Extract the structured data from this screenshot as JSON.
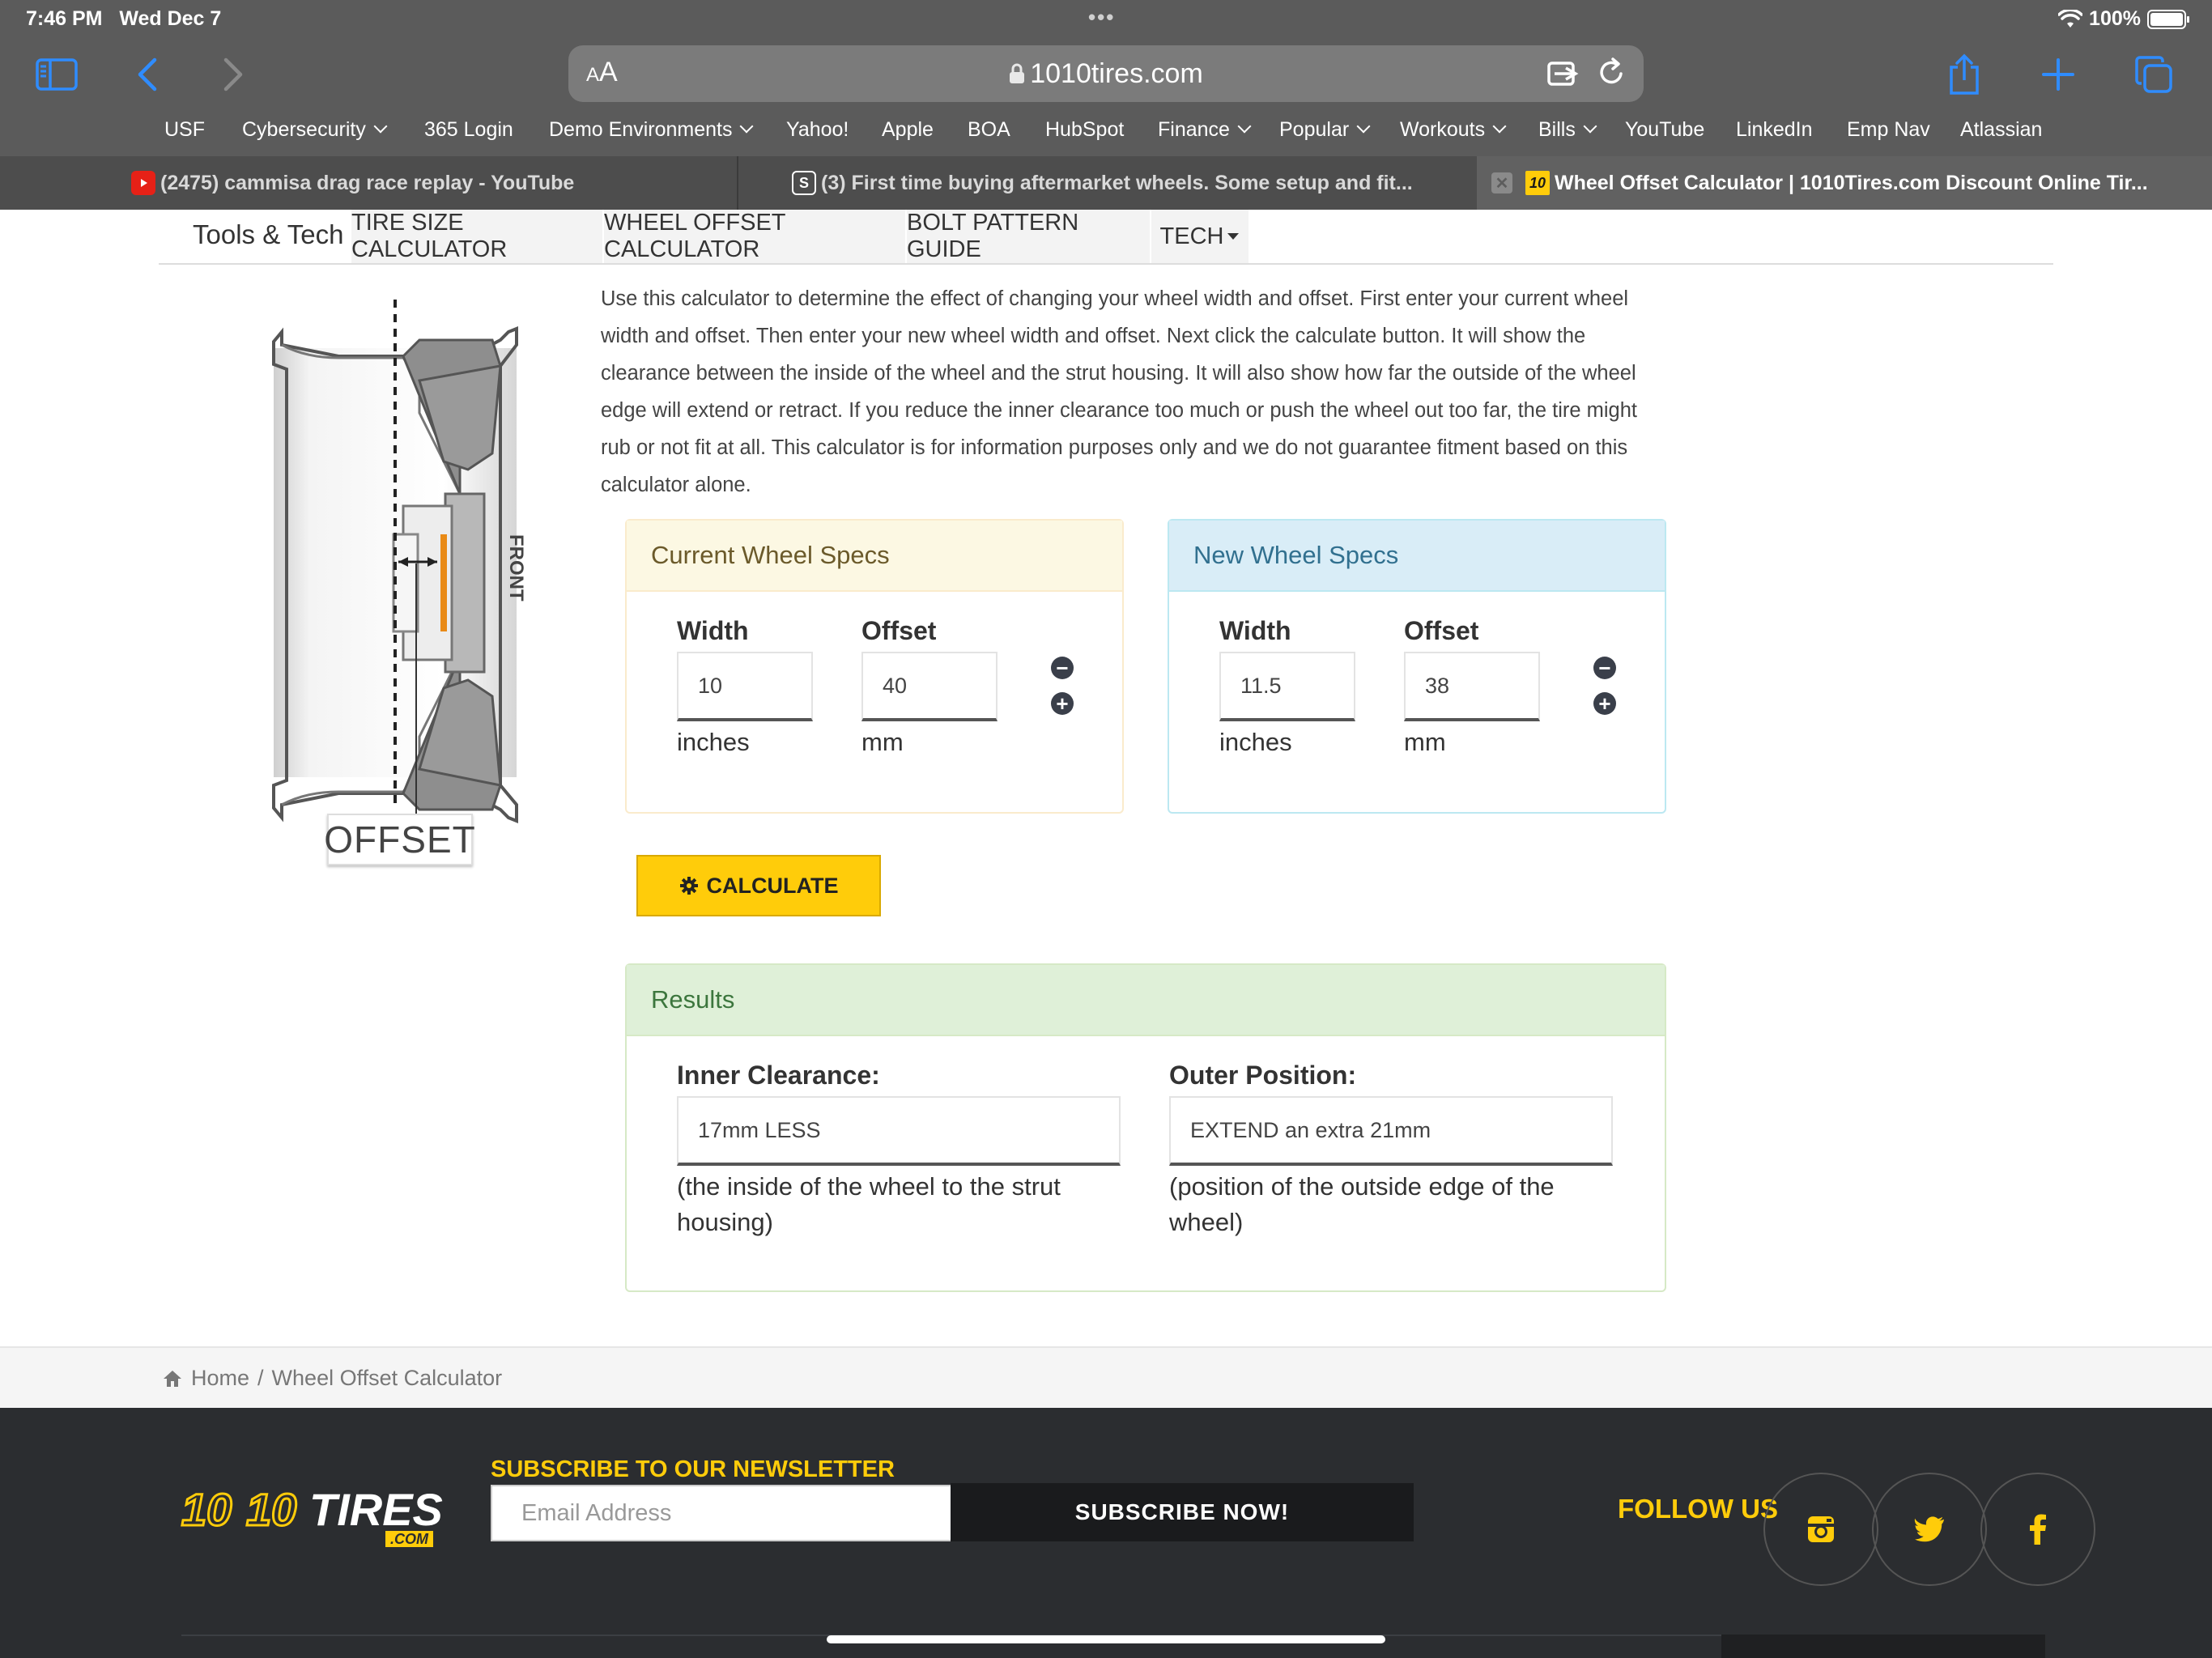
{
  "status": {
    "time": "7:46 PM",
    "date": "Wed Dec 7",
    "battery": "100%"
  },
  "browser": {
    "url_aa_big": "A",
    "url_aa_small": "A",
    "url": "1010tires.com",
    "bookmarks": [
      {
        "label": "USF",
        "menu": false
      },
      {
        "label": "Cybersecurity",
        "menu": true
      },
      {
        "label": "365 Login",
        "menu": false
      },
      {
        "label": "Demo Environments",
        "menu": true
      },
      {
        "label": "Yahoo!",
        "menu": false
      },
      {
        "label": "Apple",
        "menu": false
      },
      {
        "label": "BOA",
        "menu": false
      },
      {
        "label": "HubSpot",
        "menu": false
      },
      {
        "label": "Finance",
        "menu": true
      },
      {
        "label": "Popular",
        "menu": true
      },
      {
        "label": "Workouts",
        "menu": true
      },
      {
        "label": "Bills",
        "menu": true
      },
      {
        "label": "YouTube",
        "menu": false
      },
      {
        "label": "LinkedIn",
        "menu": false
      },
      {
        "label": "Emp Nav",
        "menu": false
      },
      {
        "label": "Atlassian",
        "menu": false
      }
    ],
    "tabs": [
      {
        "title": "(2475) cammisa drag race replay - YouTube",
        "favicon": "youtube-icon",
        "active": false
      },
      {
        "title": "(3) First time buying aftermarket wheels. Some setup and fit...",
        "favicon": "s-icon",
        "active": false
      },
      {
        "title": "Wheel Offset Calculator | 1010Tires.com Discount Online Tir...",
        "favicon": "10",
        "active": true
      }
    ]
  },
  "subnav": {
    "title": "Tools & Tech",
    "items": [
      "TIRE SIZE CALCULATOR",
      "WHEEL OFFSET CALCULATOR",
      "BOLT PATTERN GUIDE",
      "TECH"
    ]
  },
  "diagram": {
    "front_label": "FRONT",
    "offset_label": "OFFSET"
  },
  "intro": "Use this calculator to determine the effect of changing your wheel width and offset. First enter your current wheel width and offset. Then enter your new wheel width and offset. Next click the calculate button. It will show the clearance between the inside of the wheel and the strut housing. It will also show how far the outside of the wheel edge will extend or retract. If you reduce the inner clearance too much or push the wheel out too far, the tire might rub or not fit at all. This calculator is for information purposes only and we do not guarantee fitment based on this calculator alone.",
  "current": {
    "title": "Current Wheel Specs",
    "width_label": "Width",
    "width": "10",
    "width_unit": "inches",
    "offset_label": "Offset",
    "offset": "40",
    "offset_unit": "mm"
  },
  "new": {
    "title": "New Wheel Specs",
    "width_label": "Width",
    "width": "11.5",
    "width_unit": "inches",
    "offset_label": "Offset",
    "offset": "38",
    "offset_unit": "mm"
  },
  "calculate_label": "CALCULATE",
  "results": {
    "title": "Results",
    "inner_label": "Inner Clearance:",
    "inner_value": "17mm LESS",
    "inner_note": "(the inside of the wheel to the strut housing)",
    "outer_label": "Outer Position:",
    "outer_value": "EXTEND an extra 21mm",
    "outer_note": "(position of the outside edge of the wheel)"
  },
  "breadcrumb": {
    "home": "Home",
    "sep": "/",
    "current": "Wheel Offset Calculator"
  },
  "footer": {
    "logo_part1": "10",
    "logo_part2": "10",
    "logo_part3": "TIRES",
    "logo_com": ".COM",
    "newsletter_title": "SUBSCRIBE TO OUR NEWSLETTER",
    "email_placeholder": "Email Address",
    "subscribe_label": "SUBSCRIBE NOW!",
    "follow_label": "FOLLOW US"
  },
  "colors": {
    "accent": "#ffcc0a",
    "current_head_bg": "#fcf8e3",
    "current_border": "#faebcc",
    "current_head_text": "#6b5a2a",
    "new_head_bg": "#d9edf7",
    "new_border": "#bce8f1",
    "new_head_text": "#31708f",
    "results_head_bg": "#dff0d8",
    "results_border": "#d6e9c6",
    "results_head_text": "#3c763d"
  }
}
